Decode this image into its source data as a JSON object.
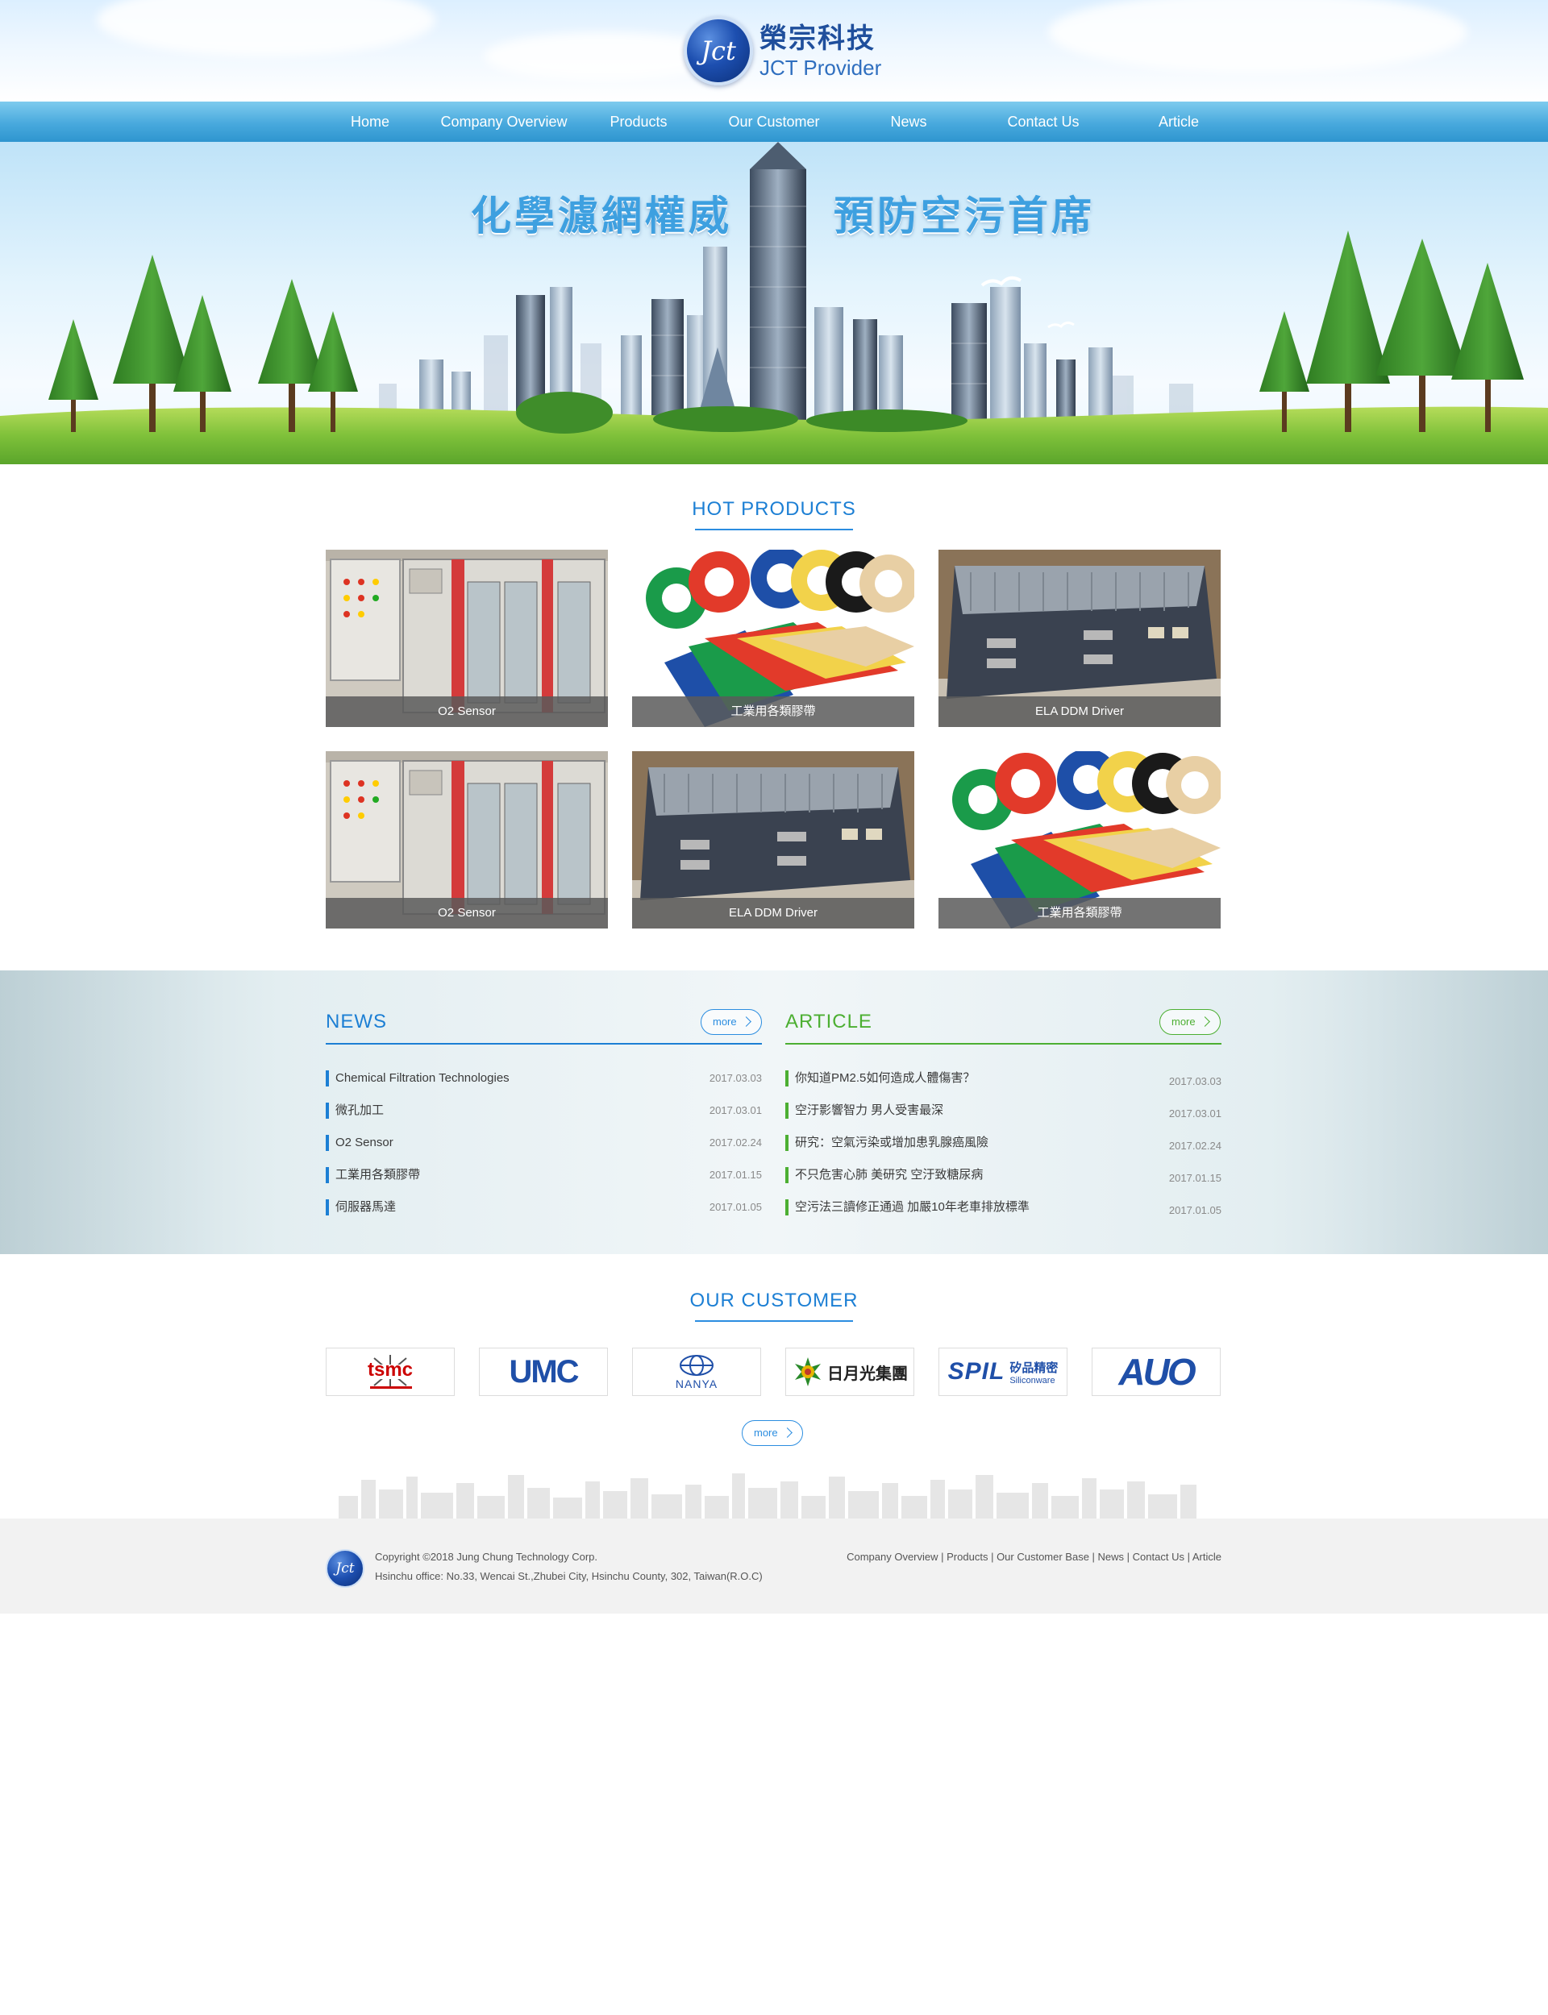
{
  "brand": {
    "logo_text": "Jct",
    "name_cn": "榮宗科技",
    "name_en": "JCT Provider"
  },
  "nav": {
    "items": [
      {
        "label": "Home"
      },
      {
        "label": "Company Overview"
      },
      {
        "label": "Products"
      },
      {
        "label": "Our Customer"
      },
      {
        "label": "News"
      },
      {
        "label": "Contact Us"
      },
      {
        "label": "Article"
      }
    ]
  },
  "banner": {
    "headline_left": "化學濾網權威",
    "headline_right": "預防空污首席"
  },
  "hot_products": {
    "title": "HOT PRODUCTS",
    "items": [
      {
        "caption": "O2 Sensor",
        "image": "cabinet"
      },
      {
        "caption": "工業用各類膠帶",
        "image": "tape"
      },
      {
        "caption": "ELA DDM Driver",
        "image": "driver"
      },
      {
        "caption": "O2 Sensor",
        "image": "cabinet"
      },
      {
        "caption": "ELA DDM Driver",
        "image": "driver"
      },
      {
        "caption": "工業用各類膠帶",
        "image": "tape"
      }
    ]
  },
  "news": {
    "title": "NEWS",
    "more_label": "more",
    "accent": "#1c7fd4",
    "items": [
      {
        "title": "Chemical Filtration Technologies",
        "date": "2017.03.03"
      },
      {
        "title": "微孔加工",
        "date": "2017.03.01"
      },
      {
        "title": "O2 Sensor",
        "date": "2017.02.24"
      },
      {
        "title": "工業用各類膠帶",
        "date": "2017.01.15"
      },
      {
        "title": "伺服器馬達",
        "date": "2017.01.05"
      }
    ]
  },
  "article": {
    "title": "ARTICLE",
    "more_label": "more",
    "accent": "#4caf32",
    "items": [
      {
        "title": "你知道PM2.5如何造成人體傷害？",
        "date": "2017.03.03"
      },
      {
        "title": "空汙影響智力 男人受害最深",
        "date": "2017.03.01"
      },
      {
        "title": "研究：空氣污染或增加患乳腺癌風險",
        "date": "2017.02.24"
      },
      {
        "title": "不只危害心肺 美研究 空汙致糖尿病",
        "date": "2017.01.15"
      },
      {
        "title": "空污法三讀修正通過 加嚴10年老車排放標準",
        "date": "2017.01.05"
      }
    ]
  },
  "customers": {
    "title": "OUR CUSTOMER",
    "more_label": "more",
    "logos": [
      {
        "name": "tsmc"
      },
      {
        "name": "UMC"
      },
      {
        "name": "NANYA"
      },
      {
        "name": "日月光集團"
      },
      {
        "name": "SPIL",
        "sub_cn": "矽品精密",
        "sub_en": "Siliconware"
      },
      {
        "name": "AUO"
      }
    ]
  },
  "footer": {
    "logo_text": "Jct",
    "copyright": "Copyright ©2018 Jung Chung Technology Corp.",
    "address": "Hsinchu office: No.33, Wencai St.,Zhubei City, Hsinchu County, 302, Taiwan(R.O.C)",
    "links": [
      {
        "label": "Company Overview"
      },
      {
        "label": "Products"
      },
      {
        "label": "Our Customer Base"
      },
      {
        "label": "News"
      },
      {
        "label": "Contact Us"
      },
      {
        "label": "Article"
      }
    ]
  }
}
